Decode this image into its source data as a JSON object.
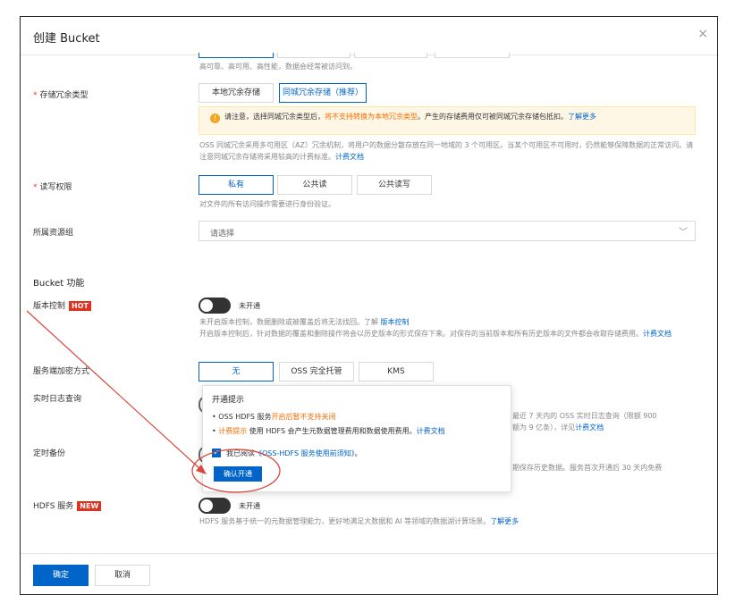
{
  "dialog": {
    "title": "创建 Bucket",
    "close_icon": "×"
  },
  "top_note": "高可靠、高可用、高性能，数据会经常被访问到。",
  "redundancy": {
    "label": "存储冗余类型",
    "options": [
      "本地冗余存储",
      "同城冗余存储（推荐）"
    ],
    "warning_icon": "!",
    "warning_prefix": "请注意，选择同城冗余类型后，",
    "warning_highlight": "将不支持转换为本地冗余类型",
    "warning_suffix": "。产生的存储费用仅可被同城冗余存储包抵扣。",
    "warning_link": "了解更多",
    "desc": "OSS 同城冗余采用多可用区（AZ）冗余机制，将用户的数据分散存放在同一地域的 3 个可用区。当某个可用区不可用时，仍然能够保障数据的正常访问。请注意同城冗余存储将采用较高的计费标准。",
    "desc_link": "计费文档"
  },
  "acl": {
    "label": "读写权限",
    "options": [
      "私有",
      "公共读",
      "公共读写"
    ],
    "desc": "对文件的所有访问操作需要进行身份验证。"
  },
  "resource_group": {
    "label": "所属资源组",
    "placeholder": "请选择",
    "chevron": "﹀"
  },
  "bucket_features": {
    "title": "Bucket 功能"
  },
  "versioning": {
    "label": "版本控制",
    "badge": "HOT",
    "status": "未开通",
    "desc1": "未开启版本控制，数据删除或被覆盖后将无法找回。了解",
    "desc1_link": "版本控制",
    "desc2": "开启版本控制后，针对数据的覆盖和删除操作将会以历史版本的形式保存下来。对保存的当前版本和所有历史版本的文件都会收取存储费用。",
    "desc2_link": "计费文档"
  },
  "encryption": {
    "label": "服务端加密方式",
    "options": [
      "无",
      "OSS 完全托管",
      "KMS"
    ]
  },
  "realtime_log": {
    "label": "实时日志查询",
    "desc1": "最近 7 天内的 OSS 实时日志查询（限额 900",
    "desc2": "额为 9 亿条），详见",
    "desc2_link": "计费文档"
  },
  "scheduled_backup": {
    "label": "定时备份",
    "desc": "期保存历史数据。服务首次开通后 30 天内免费"
  },
  "hdfs": {
    "label": "HDFS 服务",
    "badge": "NEW",
    "status": "未开通",
    "desc": "HDFS 服务基于统一的元数据管理能力，更好地满足大数据和 AI 等领域的数据湖计算场景。",
    "desc_link": "了解更多"
  },
  "popover": {
    "title": "开通提示",
    "item1_prefix": "OSS HDFS 服务",
    "item1_highlight": "开启后暂不支持关闭",
    "item2_highlight": "计费提示",
    "item2_text": " 使用 HDFS 会产生元数据管理费用和数据使用费用。",
    "item2_link": "计费文档",
    "checkbox_text": "我已阅读",
    "checkbox_link": "《OSS-HDFS 服务使用前须知》",
    "checkbox_suffix": "。",
    "confirm": "确认开通"
  },
  "footer": {
    "ok": "确定",
    "cancel": "取消"
  },
  "colors": {
    "primary": "#0064c8",
    "warning": "#f56c00",
    "hot": "#e0301e",
    "annotation": "#d9463a"
  }
}
